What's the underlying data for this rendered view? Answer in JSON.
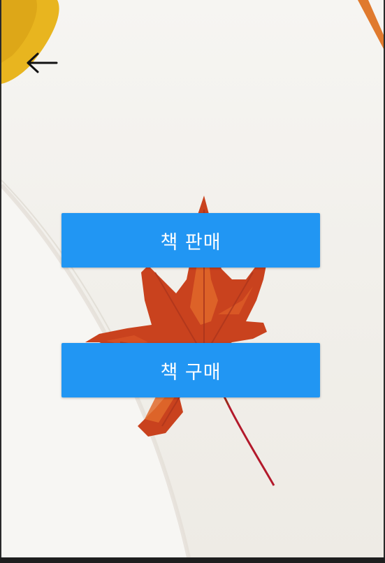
{
  "app": {
    "accent_color": "#2196f3"
  },
  "toolbar": {
    "back_icon": "arrow-left-icon"
  },
  "actions": {
    "sell_label": "책 판매",
    "buy_label": "책 구매"
  },
  "background": {
    "image": "autumn-maple-leaf-on-open-book"
  }
}
